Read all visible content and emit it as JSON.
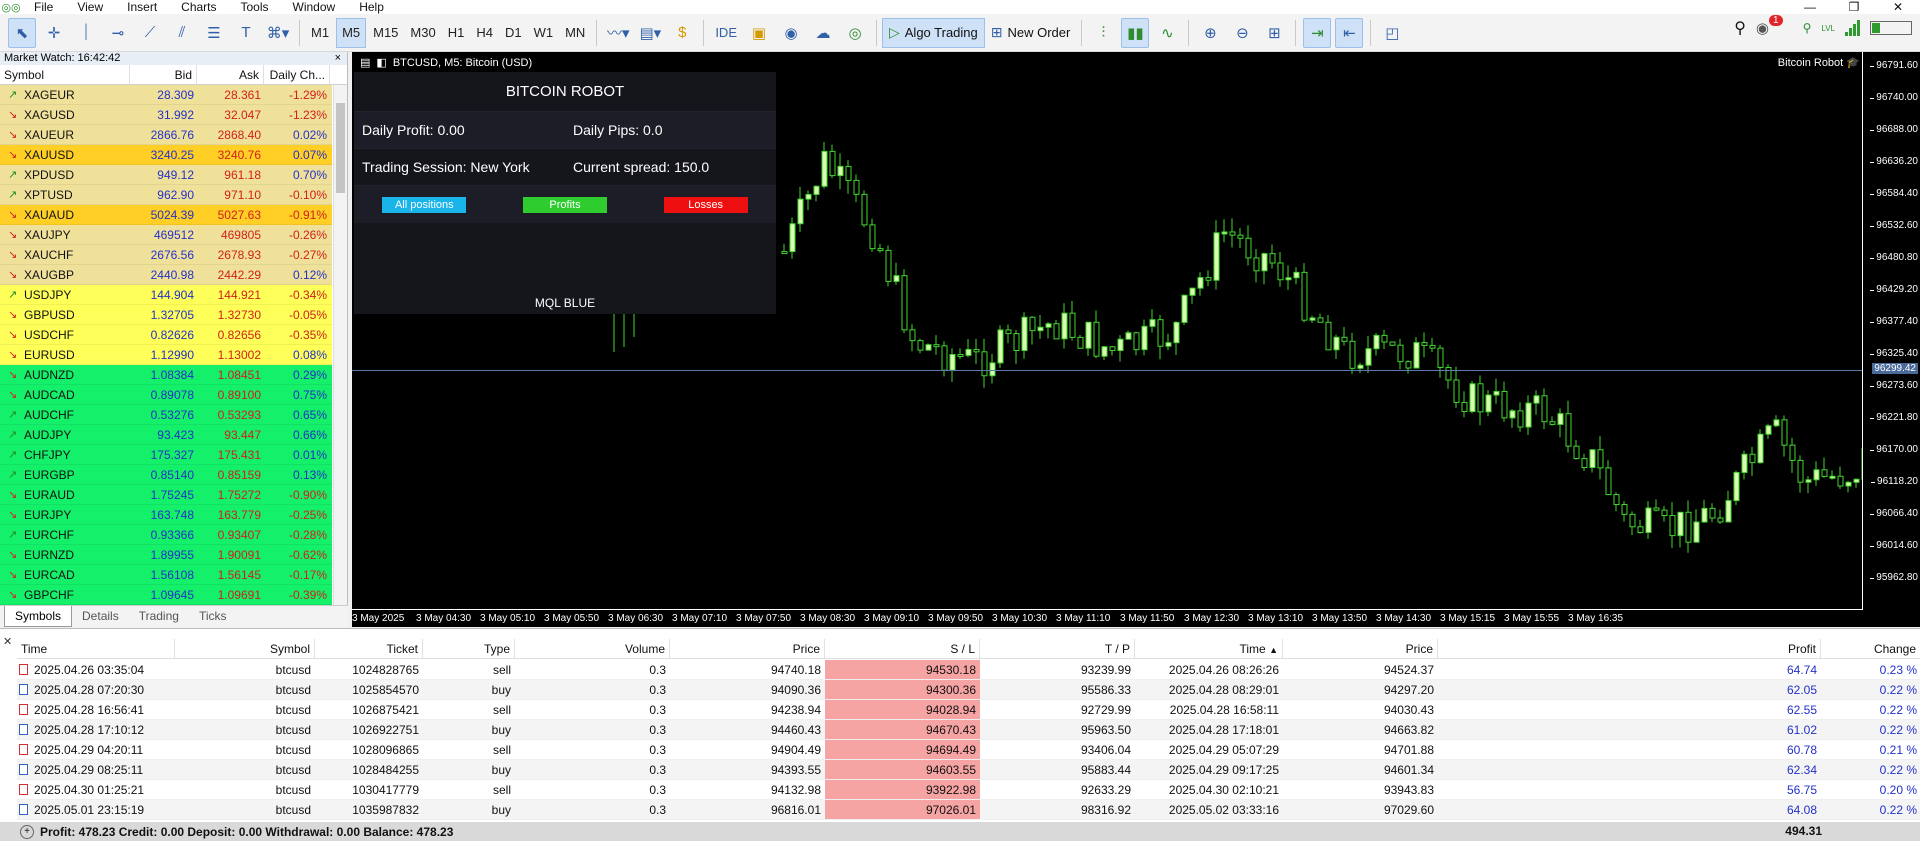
{
  "menu": {
    "items": [
      "File",
      "View",
      "Insert",
      "Charts",
      "Tools",
      "Window",
      "Help"
    ],
    "window_controls": [
      "—",
      "❐",
      "✕"
    ]
  },
  "toolbar": {
    "timeframes": [
      "M1",
      "M5",
      "M15",
      "M30",
      "H1",
      "H4",
      "D1",
      "W1",
      "MN"
    ],
    "selected_timeframe": "M5",
    "ide_label": "IDE",
    "algo_trading_label": "Algo Trading",
    "new_order_label": "New Order",
    "notification_count": "1",
    "lvl_label": "LVL"
  },
  "market_watch": {
    "title": "Market Watch: 16:42:42",
    "close": "×",
    "headers": {
      "symbol": "Symbol",
      "bid": "Bid",
      "ask": "Ask",
      "change": "Daily Ch..."
    },
    "rows": [
      {
        "symbol": "XAGEUR",
        "bid": "28.309",
        "ask": "28.361",
        "change": "-1.29%",
        "dir": "up",
        "bg": "#f0e19a"
      },
      {
        "symbol": "XAGUSD",
        "bid": "31.992",
        "ask": "32.047",
        "change": "-1.23%",
        "dir": "dn",
        "bg": "#f0e19a"
      },
      {
        "symbol": "XAUEUR",
        "bid": "2866.76",
        "ask": "2868.40",
        "change": "0.02%",
        "dir": "dn",
        "bg": "#f0e19a"
      },
      {
        "symbol": "XAUUSD",
        "bid": "3240.25",
        "ask": "3240.76",
        "change": "0.07%",
        "dir": "dn",
        "bg": "#ffcf26"
      },
      {
        "symbol": "XPDUSD",
        "bid": "949.12",
        "ask": "961.18",
        "change": "0.70%",
        "dir": "up",
        "bg": "#f0e19a"
      },
      {
        "symbol": "XPTUSD",
        "bid": "962.90",
        "ask": "971.10",
        "change": "-0.10%",
        "dir": "up",
        "bg": "#f0e19a"
      },
      {
        "symbol": "XAUAUD",
        "bid": "5024.39",
        "ask": "5027.63",
        "change": "-0.91%",
        "dir": "dn",
        "bg": "#ffcf26"
      },
      {
        "symbol": "XAUJPY",
        "bid": "469512",
        "ask": "469805",
        "change": "-0.26%",
        "dir": "dn",
        "bg": "#f0e19a"
      },
      {
        "symbol": "XAUCHF",
        "bid": "2676.56",
        "ask": "2678.93",
        "change": "-0.27%",
        "dir": "dn",
        "bg": "#f0e19a"
      },
      {
        "symbol": "XAUGBP",
        "bid": "2440.98",
        "ask": "2442.29",
        "change": "0.12%",
        "dir": "dn",
        "bg": "#f0e19a"
      },
      {
        "symbol": "USDJPY",
        "bid": "144.904",
        "ask": "144.921",
        "change": "-0.34%",
        "dir": "up",
        "bg": "#ffff5a"
      },
      {
        "symbol": "GBPUSD",
        "bid": "1.32705",
        "ask": "1.32730",
        "change": "-0.05%",
        "dir": "dn",
        "bg": "#ffff5a"
      },
      {
        "symbol": "USDCHF",
        "bid": "0.82626",
        "ask": "0.82656",
        "change": "-0.35%",
        "dir": "dn",
        "bg": "#ffff5a"
      },
      {
        "symbol": "EURUSD",
        "bid": "1.12990",
        "ask": "1.13002",
        "change": "0.08%",
        "dir": "dn",
        "bg": "#ffff5a"
      },
      {
        "symbol": "AUDNZD",
        "bid": "1.08384",
        "ask": "1.08451",
        "change": "0.29%",
        "dir": "dn",
        "bg": "#14f06a"
      },
      {
        "symbol": "AUDCAD",
        "bid": "0.89078",
        "ask": "0.89100",
        "change": "0.75%",
        "dir": "dn",
        "bg": "#14f06a"
      },
      {
        "symbol": "AUDCHF",
        "bid": "0.53276",
        "ask": "0.53293",
        "change": "0.65%",
        "dir": "up",
        "bg": "#14f06a"
      },
      {
        "symbol": "AUDJPY",
        "bid": "93.423",
        "ask": "93.447",
        "change": "0.66%",
        "dir": "up",
        "bg": "#14f06a"
      },
      {
        "symbol": "CHFJPY",
        "bid": "175.327",
        "ask": "175.431",
        "change": "0.01%",
        "dir": "up",
        "bg": "#14f06a"
      },
      {
        "symbol": "EURGBP",
        "bid": "0.85140",
        "ask": "0.85159",
        "change": "0.13%",
        "dir": "up",
        "bg": "#14f06a"
      },
      {
        "symbol": "EURAUD",
        "bid": "1.75245",
        "ask": "1.75272",
        "change": "-0.90%",
        "dir": "dn",
        "bg": "#14f06a"
      },
      {
        "symbol": "EURJPY",
        "bid": "163.748",
        "ask": "163.779",
        "change": "-0.25%",
        "dir": "dn",
        "bg": "#14f06a"
      },
      {
        "symbol": "EURCHF",
        "bid": "0.93366",
        "ask": "0.93407",
        "change": "-0.28%",
        "dir": "up",
        "bg": "#14f06a"
      },
      {
        "symbol": "EURNZD",
        "bid": "1.89955",
        "ask": "1.90091",
        "change": "-0.62%",
        "dir": "dn",
        "bg": "#14f06a"
      },
      {
        "symbol": "EURCAD",
        "bid": "1.56108",
        "ask": "1.56145",
        "change": "-0.17%",
        "dir": "dn",
        "bg": "#14f06a"
      },
      {
        "symbol": "GBPCHF",
        "bid": "1.09645",
        "ask": "1.09691",
        "change": "-0.39%",
        "dir": "dn",
        "bg": "#14f06a"
      }
    ],
    "tabs": [
      "Symbols",
      "Details",
      "Trading",
      "Ticks"
    ],
    "active_tab": "Symbols"
  },
  "chart": {
    "title": "BTCUSD, M5:  Bitcoin (USD)",
    "robot_label": "Bitcoin Robot",
    "current_price": "96299.42",
    "price_ticks": [
      "96791.60",
      "96740.00",
      "96688.00",
      "96636.20",
      "96584.40",
      "96532.60",
      "96480.80",
      "96429.20",
      "96377.40",
      "96325.40",
      "96273.60",
      "96221.80",
      "96170.00",
      "96118.20",
      "96066.40",
      "96014.60",
      "95962.80"
    ],
    "time_ticks": [
      "3 May 2025",
      "3 May 04:30",
      "3 May 05:10",
      "3 May 05:50",
      "3 May 06:30",
      "3 May 07:10",
      "3 May 07:50",
      "3 May 08:30",
      "3 May 09:10",
      "3 May 09:50",
      "3 May 10:30",
      "3 May 11:10",
      "3 May 11:50",
      "3 May 12:30",
      "3 May 13:10",
      "3 May 13:50",
      "3 May 14:30",
      "3 May 15:15",
      "3 May 15:55",
      "3 May 16:35"
    ],
    "candle_color": "#d8ffb0",
    "wick_color": "#42d62e"
  },
  "robot_panel": {
    "title": "BITCOIN ROBOT",
    "daily_profit": "Daily Profit: 0.00",
    "daily_pips": "Daily Pips:  0.0",
    "trading_session": "Trading Session: New York",
    "current_spread": "Current spread: 150.0",
    "buttons": [
      {
        "label": "All positions",
        "color": "#18b4ea"
      },
      {
        "label": "Profits",
        "color": "#2fcc2f"
      },
      {
        "label": "Losses",
        "color": "#ee1010"
      }
    ],
    "footer": "MQL BLUE"
  },
  "history": {
    "headers": [
      "Time",
      "Symbol",
      "Ticket",
      "Type",
      "Volume",
      "Price",
      "S / L",
      "T / P",
      "Time",
      "Price",
      "Profit",
      "Change"
    ],
    "rows": [
      {
        "time": "2025.04.26 03:35:04",
        "symbol": "btcusd",
        "ticket": "1024828765",
        "type": "sell",
        "volume": "0.3",
        "price": "94740.18",
        "sl": "94530.18",
        "tp": "93239.99",
        "close_time": "2025.04.26 08:26:26",
        "close_price": "94524.37",
        "profit": "64.74",
        "change": "0.23 %"
      },
      {
        "time": "2025.04.28 07:20:30",
        "symbol": "btcusd",
        "ticket": "1025854570",
        "type": "buy",
        "volume": "0.3",
        "price": "94090.36",
        "sl": "94300.36",
        "tp": "95586.33",
        "close_time": "2025.04.28 08:29:01",
        "close_price": "94297.20",
        "profit": "62.05",
        "change": "0.22 %"
      },
      {
        "time": "2025.04.28 16:56:41",
        "symbol": "btcusd",
        "ticket": "1026875421",
        "type": "sell",
        "volume": "0.3",
        "price": "94238.94",
        "sl": "94028.94",
        "tp": "92729.99",
        "close_time": "2025.04.28 16:58:11",
        "close_price": "94030.43",
        "profit": "62.55",
        "change": "0.22 %"
      },
      {
        "time": "2025.04.28 17:10:12",
        "symbol": "btcusd",
        "ticket": "1026922751",
        "type": "buy",
        "volume": "0.3",
        "price": "94460.43",
        "sl": "94670.43",
        "tp": "95963.50",
        "close_time": "2025.04.28 17:18:01",
        "close_price": "94663.82",
        "profit": "61.02",
        "change": "0.22 %"
      },
      {
        "time": "2025.04.29 04:20:11",
        "symbol": "btcusd",
        "ticket": "1028096865",
        "type": "sell",
        "volume": "0.3",
        "price": "94904.49",
        "sl": "94694.49",
        "tp": "93406.04",
        "close_time": "2025.04.29 05:07:29",
        "close_price": "94701.88",
        "profit": "60.78",
        "change": "0.21 %"
      },
      {
        "time": "2025.04.29 08:25:11",
        "symbol": "btcusd",
        "ticket": "1028484255",
        "type": "buy",
        "volume": "0.3",
        "price": "94393.55",
        "sl": "94603.55",
        "tp": "95883.44",
        "close_time": "2025.04.29 09:17:25",
        "close_price": "94601.34",
        "profit": "62.34",
        "change": "0.22 %"
      },
      {
        "time": "2025.04.30 01:25:21",
        "symbol": "btcusd",
        "ticket": "1030417779",
        "type": "sell",
        "volume": "0.3",
        "price": "94132.98",
        "sl": "93922.98",
        "tp": "92633.29",
        "close_time": "2025.04.30 02:10:21",
        "close_price": "93943.83",
        "profit": "56.75",
        "change": "0.20 %"
      },
      {
        "time": "2025.05.01 23:15:19",
        "symbol": "btcusd",
        "ticket": "1035987832",
        "type": "buy",
        "volume": "0.3",
        "price": "96816.01",
        "sl": "97026.01",
        "tp": "98316.92",
        "close_time": "2025.05.02 03:33:16",
        "close_price": "97029.60",
        "profit": "64.08",
        "change": "0.22 %"
      }
    ],
    "footer": "Profit: 478.23  Credit: 0.00  Deposit: 0.00  Withdrawal: 0.00  Balance: 478.23",
    "total": "494.31"
  }
}
